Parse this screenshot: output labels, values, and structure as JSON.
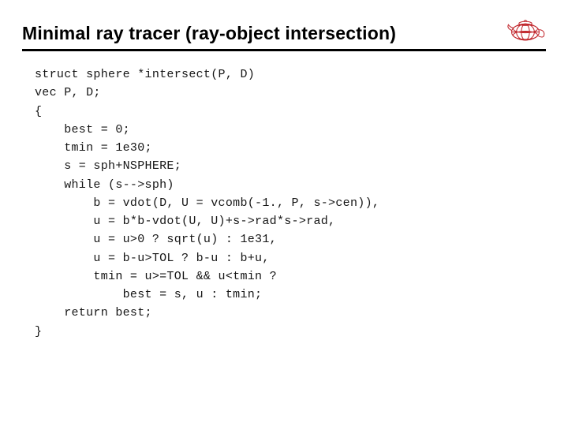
{
  "title": "Minimal ray tracer (ray-object intersection)",
  "code": "struct sphere *intersect(P, D)\nvec P, D;\n{\n    best = 0;\n    tmin = 1e30;\n    s = sph+NSPHERE;\n    while (s-->sph)\n        b = vdot(D, U = vcomb(-1., P, s->cen)),\n        u = b*b-vdot(U, U)+s->rad*s->rad,\n        u = u>0 ? sqrt(u) : 1e31,\n        u = b-u>TOL ? b-u : b+u,\n        tmin = u>=TOL && u<tmin ?\n            best = s, u : tmin;\n    return best;\n}"
}
